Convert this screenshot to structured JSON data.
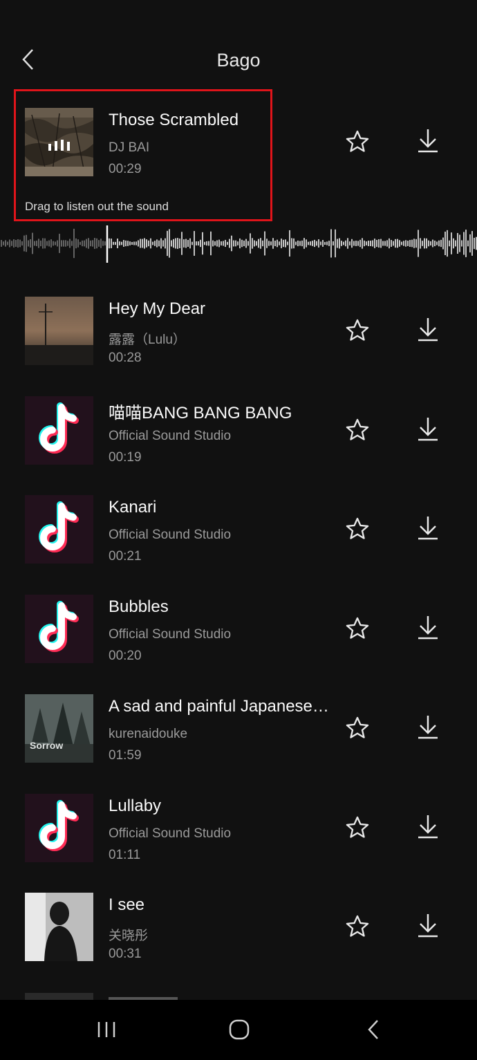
{
  "header": {
    "title": "Bago",
    "back_icon": "chevron-left-icon"
  },
  "selected_track": {
    "title": "Those Scrambled",
    "artist": "DJ BAI",
    "duration": "00:29",
    "drag_hint": "Drag to listen out the sound",
    "state": "playing"
  },
  "tracks": [
    {
      "title": "Hey My Dear",
      "artist": "露露（Lulu）",
      "duration": "00:28",
      "cover": "sunset-photo"
    },
    {
      "title": "喵喵BANG BANG BANG",
      "artist": "Official Sound Studio",
      "duration": "00:19",
      "cover": "tiktok-logo"
    },
    {
      "title": "Kanari",
      "artist": "Official Sound Studio",
      "duration": "00:21",
      "cover": "tiktok-logo"
    },
    {
      "title": "Bubbles",
      "artist": "Official Sound Studio",
      "duration": "00:20",
      "cover": "tiktok-logo"
    },
    {
      "title": "A sad and painful Japanese…",
      "artist": "kurenaidouke",
      "duration": "01:59",
      "cover": "forest-photo",
      "cover_text": "Sorrow"
    },
    {
      "title": "Lullaby",
      "artist": "Official Sound Studio",
      "duration": "01:11",
      "cover": "tiktok-logo"
    },
    {
      "title": "I see",
      "artist": "关晓彤",
      "duration": "00:31",
      "cover": "portrait-photo"
    }
  ],
  "colors": {
    "background": "#111111",
    "highlight": "#e0141a",
    "secondary_text": "#9a9a9a",
    "tiktok_cyan": "#25f4ee",
    "tiktok_red": "#fe2c55"
  },
  "navbar": {
    "icons": [
      "recent-apps-icon",
      "home-icon",
      "back-icon"
    ]
  }
}
